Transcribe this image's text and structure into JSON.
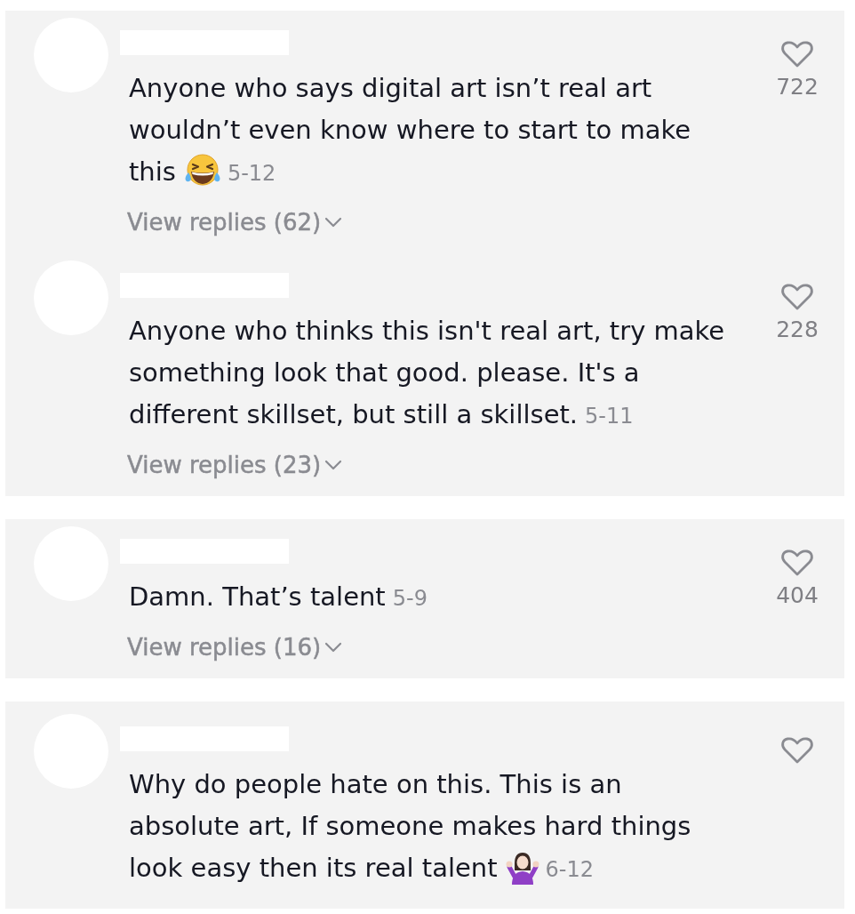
{
  "cards": [
    {
      "comments": [
        {
          "text": "Anyone who says digital art isn’t real art wouldn’t even know where to start to make this",
          "emoji": {
            "kind": "laughing"
          },
          "date": "5-12",
          "replies_link": "View replies (62)",
          "likes": "722",
          "liked": false
        },
        {
          "text": "Anyone who thinks this isn't real art, try make something look that good. please. It's a different skillset, but still a skillset.",
          "date": "5-11",
          "replies_link": "View replies (23)",
          "likes": "228",
          "liked": false
        }
      ]
    },
    {
      "comments": [
        {
          "text": "Damn. That’s talent",
          "date": "5-9",
          "replies_link": "View replies (16)",
          "likes": "404",
          "liked": false
        }
      ]
    },
    {
      "comments": [
        {
          "text": "Why do people hate on this. This is an absolute art, If someone makes hard things look easy then its real talent",
          "emoji": {
            "kind": "shrug"
          },
          "date": "6-12",
          "liked": false
        }
      ]
    }
  ]
}
